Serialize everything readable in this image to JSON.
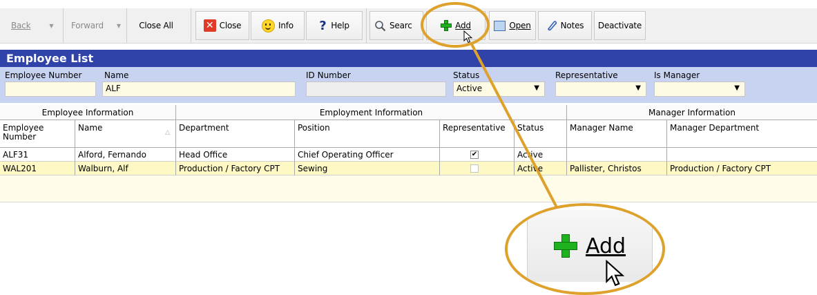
{
  "toolbar": {
    "back": "Back",
    "forward": "Forward",
    "close_all": "Close All",
    "close": "Close",
    "info": "Info",
    "help": "Help",
    "search": "Searc",
    "add": "Add",
    "open": "Open",
    "notes": "Notes",
    "deactivate": "Deactivate"
  },
  "panel": {
    "title": "Employee List"
  },
  "filters": {
    "employee_number": {
      "label": "Employee Number",
      "value": ""
    },
    "name": {
      "label": "Name",
      "value": "ALF"
    },
    "id_number": {
      "label": "ID Number",
      "value": ""
    },
    "status": {
      "label": "Status",
      "value": "Active"
    },
    "representative": {
      "label": "Representative",
      "value": ""
    },
    "is_manager": {
      "label": "Is Manager",
      "value": ""
    }
  },
  "grid": {
    "groups": [
      "Employee Information",
      "Employment Information",
      "Manager Information"
    ],
    "columns": [
      "Employee Number",
      "Name",
      "Department",
      "Position",
      "Representative",
      "Status",
      "Manager Name",
      "Manager Department"
    ],
    "rows": [
      {
        "employee_number": "ALF31",
        "name": "Alford, Fernando",
        "department": "Head Office",
        "position": "Chief Operating Officer",
        "representative": true,
        "status": "Active",
        "manager_name": "",
        "manager_department": ""
      },
      {
        "employee_number": "WAL201",
        "name": "Walburn, Alf",
        "department": "Production / Factory CPT",
        "position": "Sewing",
        "representative": false,
        "status": "Active",
        "manager_name": "Pallister, Christos",
        "manager_department": "Production / Factory CPT"
      }
    ]
  },
  "callout": {
    "label": "Add"
  },
  "colors": {
    "accent_ring": "#dda12c",
    "title_bar": "#2f43a8",
    "filter_bg": "#c7d3f0",
    "selected_row": "#fdf8c4"
  }
}
